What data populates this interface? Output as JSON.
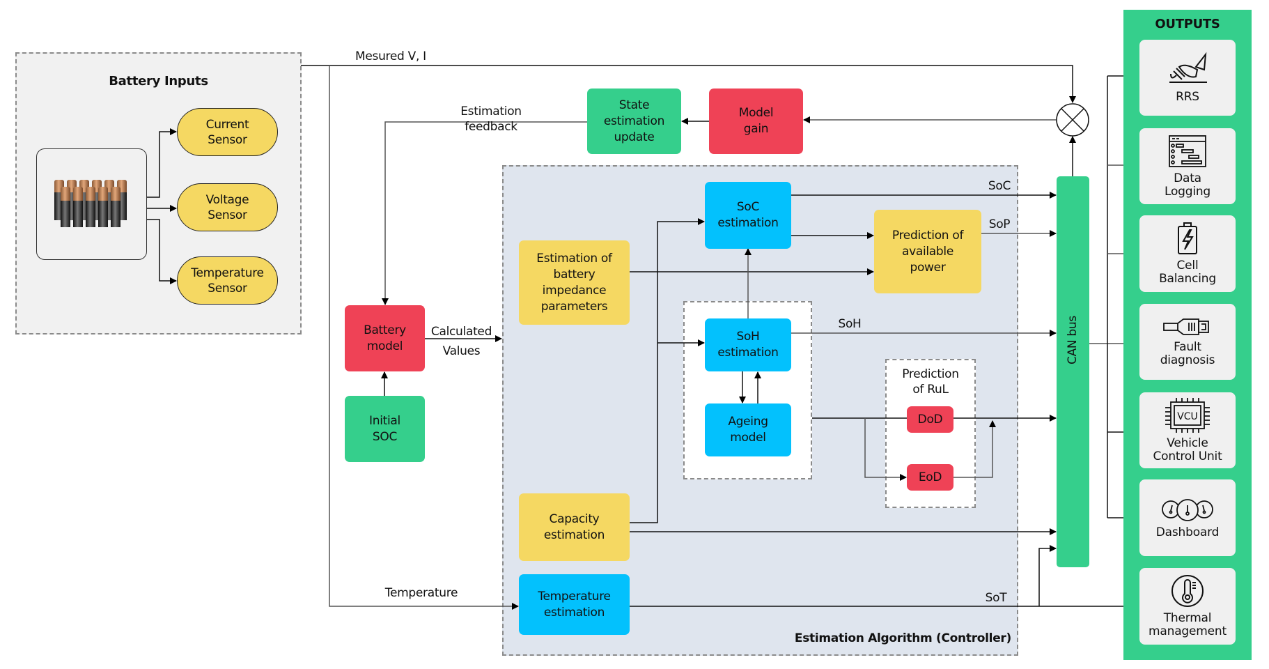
{
  "battery_inputs": {
    "title": "Battery Inputs",
    "sensors": [
      "Current\nSensor",
      "Voltage\nSensor",
      "Temperature\nSensor"
    ]
  },
  "wire_labels": {
    "measured": "Mesured V, I",
    "feedback": "Estimation\nfeedback",
    "calculated": "Calculated\nValues",
    "temperature": "Temperature",
    "soc": "SoC",
    "sop": "SoP",
    "soh": "SoH",
    "sot": "SoT"
  },
  "blocks": {
    "state_update": "State\nestimation\nupdate",
    "model_gain": "Model\ngain",
    "battery_model": "Battery\nmodel",
    "initial_soc": "Initial\nSOC",
    "impedance": "Estimation of\nbattery\nimpedance\nparameters",
    "soc_est": "SoC\nestimation",
    "power_pred": "Prediction of\navailable\npower",
    "soh_est": "SoH\nestimation",
    "ageing": "Ageing\nmodel",
    "rul_title": "Prediction\nof RuL",
    "dod": "DoD",
    "eod": "EoD",
    "capacity": "Capacity\nestimation",
    "temp_est": "Temperature\nestimation",
    "controller_title": "Estimation Algorithm (Controller)",
    "can_bus": "CAN bus"
  },
  "outputs": {
    "title": "OUTPUTS",
    "items": [
      {
        "label": "RRS",
        "icon": "brake-pedal-icon"
      },
      {
        "label": "Data\nLogging",
        "icon": "data-log-icon"
      },
      {
        "label": "Cell\nBalancing",
        "icon": "battery-bolt-icon"
      },
      {
        "label": "Fault\ndiagnosis",
        "icon": "connector-plug-icon"
      },
      {
        "label": "Vehicle\nControl Unit",
        "icon": "vcu-chip-icon",
        "chip_text": "VCU"
      },
      {
        "label": "Dashboard",
        "icon": "gauges-icon"
      },
      {
        "label": "Thermal\nmanagement",
        "icon": "thermometer-icon"
      }
    ]
  },
  "colors": {
    "yellow": "#f5d862",
    "red": "#ef4256",
    "green": "#35cf8c",
    "blue": "#03c1fd",
    "controller_bg": "#dfe5ee",
    "inputs_bg": "#f1f1f1"
  }
}
